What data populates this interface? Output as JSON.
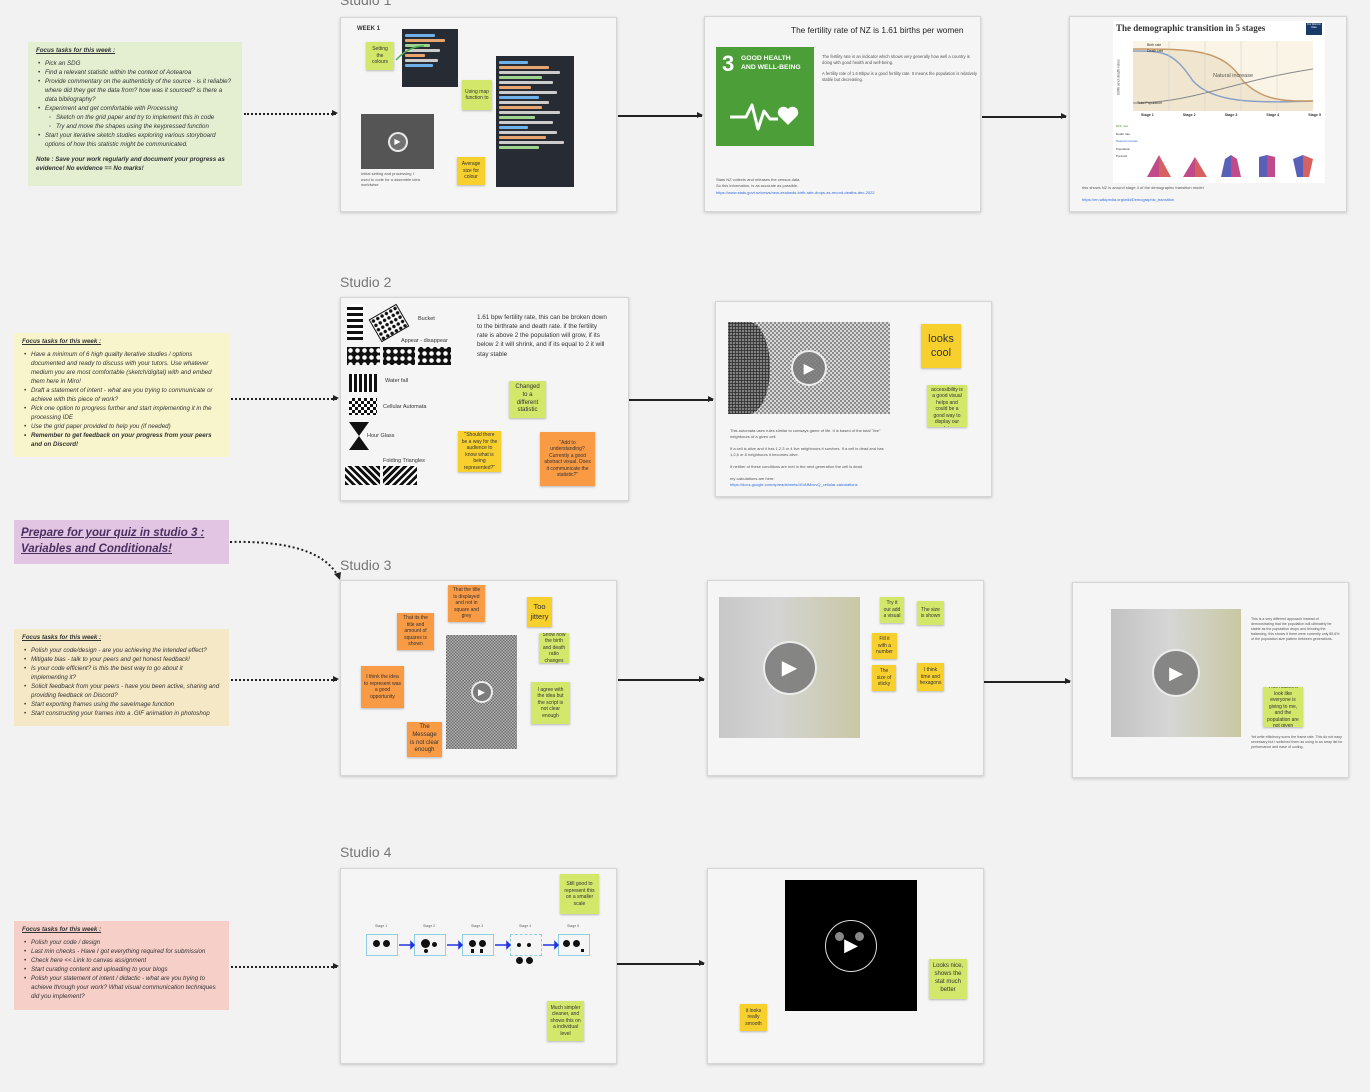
{
  "studios": {
    "s1": "Studio 1",
    "s2": "Studio 2",
    "s3": "Studio 3",
    "s4": "Studio 4"
  },
  "tasks": {
    "t1": {
      "title": "Focus tasks for this week :",
      "items": [
        "Pick an SDG",
        "Find a relevant statistic within the context of Aotearoa",
        "Provide commentary on the authenticity of the source - is it reliable? where did they get the data from? how was it sourced? is there a data bibliography?",
        "Experiment and get comfortable with Processing",
        "Sketch on the grid paper and try to implement this in code",
        "Try and move the shapes using the keypressed function",
        "Start your iterative sketch studies exploring various storyboard options of how this statistic might be communicated."
      ],
      "note": "Note : Save your work regularly and document your progress as evidence! No evidence == No marks!"
    },
    "t2": {
      "title": "Focus tasks for this week :",
      "items": [
        "Have a minimum of 6 high quality iterative studies / options documented and ready to discuss with your tutors. Use whatever medium you are most comfortable (sketch/digital) with and embed them here in Miro!",
        "Draft a statement of intent - what are you trying to communicate or achieve with this piece of work?",
        "Pick one option to progress further and start implementing it in the processing IDE",
        "Use the grid paper provided to help you (if needed)",
        "Remember to get feedback on your progress from your peers and on Discord!"
      ]
    },
    "quiz": "Prepare for your quiz in studio 3 : Variables and Conditionals!",
    "t3": {
      "title": "Focus tasks for this week :",
      "items": [
        "Polish your code/design - are you achieving the intended effect?",
        "Mitigate bias - talk to your peers and get honest feedback!",
        "Is your code efficient? is this the best way to go about it implementing it?",
        "Solicit feedback from your peers - have you been active, sharing and providing feedback on Discord?",
        "Start exporting frames using the saveImage function",
        "Start constructing your frames into a .GIF animation in photoshop"
      ]
    },
    "t4": {
      "title": "Focus tasks for this week :",
      "items": [
        "Polish your code / design",
        "Last min checks - Have I got everything required for submission",
        "Check here << Link to canvas assignment",
        "Start curating content and uploading to your blogs",
        "Polish your statement of intent / didactic - what are you trying to achieve through your work? What visual communication techniques did you implement?"
      ]
    }
  },
  "s1": {
    "week_label": "WEEK 1",
    "sticky_colours": "Setting the colours",
    "sticky_map": "Using map function to",
    "sticky_scale": "Average size for colour",
    "video_caption": "Initial setting and processing I used to code for a assemble idea worldwise",
    "fertility_title": "The fertility rate of NZ is 1.61 births per women",
    "sdg_number": "3",
    "sdg_text": "GOOD HEALTH AND WELL-BEING",
    "fertility_p1": "The fertility rate is an indicator which shows very generally how well a country is doing with good health and well-being.",
    "fertility_p2": "A fertility rate of 1.6 Bbpw is a good fertility rate. It means the population is relatively stable but decreasing.",
    "fertility_source": "Stats NZ collects and releases the census data. So this information, is as accurate as possible.",
    "fertility_link": "https://www.stats.govt.nz/news/new-zealands-birth-rate-drops-as-record-deaths-dec-2022",
    "demo_title": "The demographic transition in 5 stages",
    "demo_badge": "Our World in Data",
    "demo_ylabel": "Birth and death rates",
    "demo_birth": "Birth rate",
    "demo_death": "Death rate",
    "demo_total": "Total Population",
    "demo_natural": "Natural increase",
    "demo_stages": [
      "Stage 1",
      "Stage 2",
      "Stage 3",
      "Stage 4",
      "Stage 5"
    ],
    "demo_rows": [
      "Birth rate",
      "Death rate",
      "Natural increase",
      "Population Pyramid"
    ],
    "demo_caption": "this shows NZ is around stage 4 of the demographic transition model",
    "demo_link": "https://en.wikipedia.org/wiki/Demographic_transition"
  },
  "s2": {
    "labels": [
      "Bucket",
      "Appear - disappear",
      "Water fall",
      "Cellular Automata",
      "Hour Glass",
      "Folding Triangles"
    ],
    "rate_text": "1.61 bpw fertility rate, this can be broken down to the birthrate and death rate. if the fertility rate is above 2 the population will grow, if its below 2 it will shrink, and if its equal to 2 it will stay stable",
    "sticky_changed": "Changed to a different statistic",
    "sticky_q1": "\"Should there be a way for the audience to know what is being represented?\"",
    "sticky_q2": "\"Add to understanding? Currently a good abstract visual. Does it communicate the statistic?\"",
    "sticky_looks": "looks cool",
    "sticky_think": "think colour accessibility is a good visual helps and could be a good way to display our data",
    "cellular_text1": "This automata uses rules similar to conways game of life. It is based of the total \"live\" neighbours of a given cell.",
    "cellular_text2": "If a cell is alive and it has 1,2,3 or 4 live neighbours it survives. If a cell is dead and has 1,2,6 or 8 neighbours it becomes alive.",
    "cellular_text3": "If neither of these conditions are met in the next generation the cell is dead",
    "cellular_calc": "my calculations are here:",
    "cellular_link": "https://docs.google.com/spreadsheets/d/1AfMxuvQ_cellular-calculations"
  },
  "s3": {
    "sticky_orange1": "That its the title and amount of squares is shown",
    "sticky_orange2": "That the title is displayed and not in square and grey",
    "sticky_orange3": "I think the idea to represent was a good opportunity",
    "sticky_message": "The Message is not clear enough",
    "sticky_jittery": "Too jittery",
    "sticky_lime1": "Show how the birth and death ratio changes",
    "sticky_lime2": "I agree with the idea but the script is not clear enough",
    "note_a": "Try it out add a visual",
    "note_b": "The size is shown",
    "note_c": "Fill it with a number",
    "note_d": "The size of sticky",
    "note_e": "I think time and hexagons",
    "v3_text1": "This is a very different approach instead of demonstrating that the population will ultimately be stable as the population drops and thinning the balancing, this shows it there were currently only 85.6% of the population size pattern between generations.",
    "v3_sticky": "This makes it look like everyone is giving to me, and the population are not given",
    "v3_text2": "Yet write efficiency sums the frame rate. This do not easy necessary but I switched them as using to an array list for performance and ease of coding."
  },
  "s4": {
    "stages": [
      "Stage 1",
      "Stage 2",
      "Stage 3",
      "Stage 4",
      "Stage 5"
    ],
    "sticky_pr": "Still good to represent this on a smaller scale",
    "sticky_simpler": "Much simpler cleaner, and shows this on a individual level",
    "sticky_smooth": "it looks really smooth",
    "sticky_nice": "Looks nice, shows the stat much better"
  },
  "colors": {
    "green_note": "#e3efd0",
    "yellow_note": "#f8f5cc",
    "purple_note": "#e2c5e3",
    "peach_note": "#f5e8c6",
    "red_note": "#f6cfc9",
    "sdg_green": "#4c9f38"
  }
}
